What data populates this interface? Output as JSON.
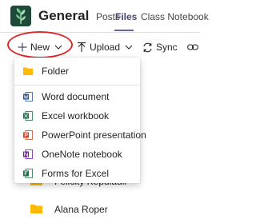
{
  "header": {
    "team_name": "General",
    "tabs": [
      {
        "label": "Posts"
      },
      {
        "label": "Files"
      },
      {
        "label": "Class Notebook"
      }
    ],
    "active_tab": "Files"
  },
  "toolbar": {
    "new_label": "New",
    "upload_label": "Upload",
    "sync_label": "Sync"
  },
  "new_menu": {
    "items": [
      {
        "label": "Folder",
        "icon": "folder-icon"
      },
      {
        "label": "Word document",
        "icon": "word-icon"
      },
      {
        "label": "Excel workbook",
        "icon": "excel-icon"
      },
      {
        "label": "PowerPoint presentation",
        "icon": "powerpoint-icon"
      },
      {
        "label": "OneNote notebook",
        "icon": "onenote-icon"
      },
      {
        "label": "Forms for Excel",
        "icon": "forms-icon"
      }
    ]
  },
  "files": [
    {
      "name": "Felicity Kepulauli"
    },
    {
      "name": "Alana Roper"
    }
  ],
  "colors": {
    "accent": "#6264a7",
    "highlight_ellipse": "#d92b2b",
    "folder": "#ffb900",
    "word": "#2b579a",
    "excel": "#217346",
    "powerpoint": "#d24726",
    "onenote": "#7719aa",
    "forms": "#217346"
  }
}
